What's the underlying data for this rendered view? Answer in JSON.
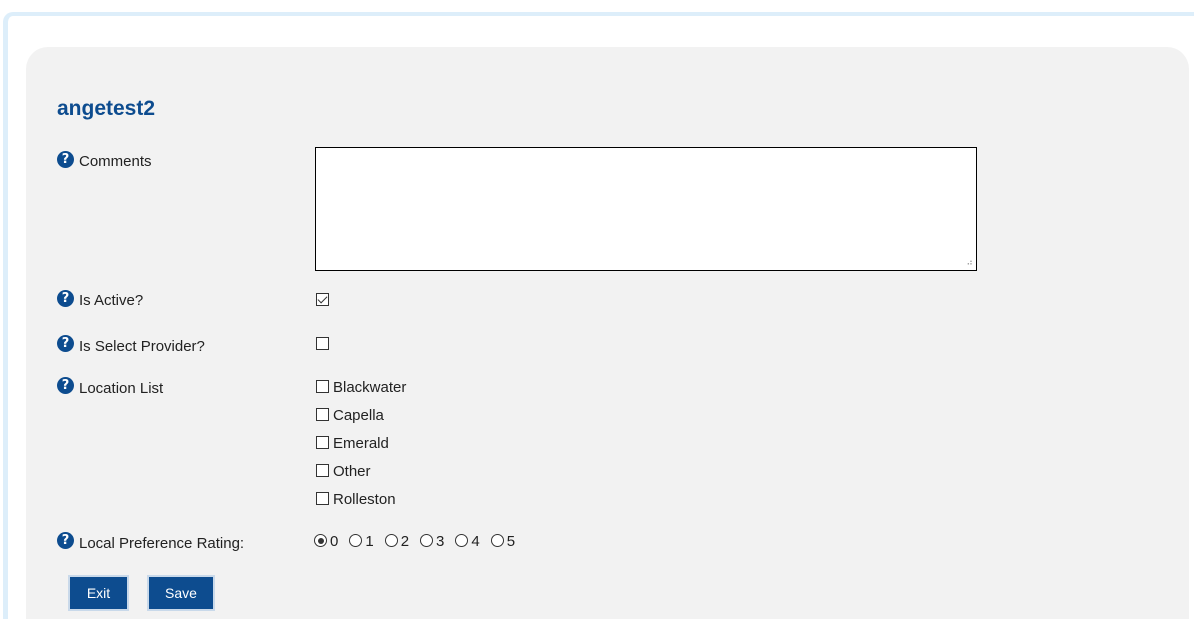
{
  "form": {
    "title": "angetest2",
    "help_icon_glyph": "?",
    "comments": {
      "label": "Comments",
      "value": ""
    },
    "is_active": {
      "label": "Is Active?",
      "checked": true
    },
    "is_select_provider": {
      "label": "Is Select Provider?",
      "checked": false
    },
    "location_list": {
      "label": "Location List",
      "options": [
        {
          "label": "Blackwater",
          "checked": false
        },
        {
          "label": "Capella",
          "checked": false
        },
        {
          "label": "Emerald",
          "checked": false
        },
        {
          "label": "Other",
          "checked": false
        },
        {
          "label": "Rolleston",
          "checked": false
        }
      ]
    },
    "local_preference_rating": {
      "label": "Local Preference Rating:",
      "options": [
        "0",
        "1",
        "2",
        "3",
        "4",
        "5"
      ],
      "selected": "0"
    },
    "buttons": {
      "exit_label": "Exit",
      "save_label": "Save"
    }
  },
  "colors": {
    "title": "#0d4c8f",
    "help_icon": "#0d4c8f",
    "button_bg": "#0d4c8f",
    "panel_bg": "#f2f2f2",
    "frame_border": "#ddeefa"
  },
  "icons": {
    "help": "question-circle-icon",
    "resize": "resize-grip-icon"
  }
}
